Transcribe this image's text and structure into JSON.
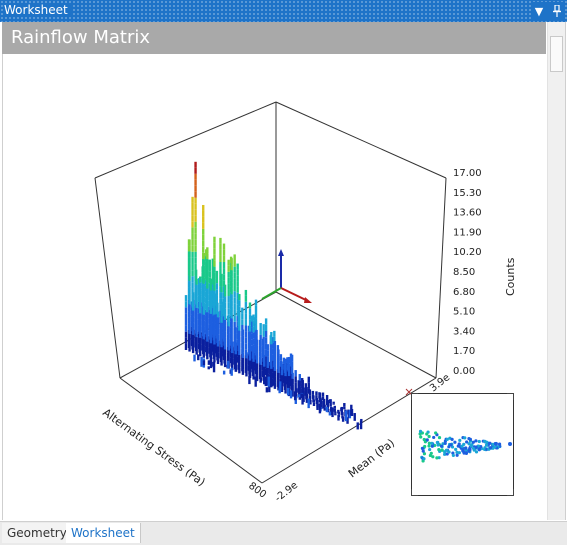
{
  "window": {
    "title": "Worksheet",
    "dropdown_icon": "chevron-down-icon",
    "pin_icon": "pin-icon"
  },
  "header": {
    "title": "Rainflow Matrix"
  },
  "chart_data": {
    "type": "bar3d",
    "z_axis": {
      "label": "Counts",
      "ticks": [
        "17.00",
        "15.30",
        "13.60",
        "11.90",
        "10.20",
        "8.50",
        "6.80",
        "5.10",
        "3.40",
        "1.70",
        "0.00"
      ],
      "range": [
        0,
        17
      ]
    },
    "x_axis": {
      "label": "Alternating Stress (Pa)",
      "end_tick": "800"
    },
    "y_axis": {
      "label": "Mean (Pa)",
      "start_tick": "-2.9e",
      "end_tick": "3.9e"
    },
    "colormap": [
      "#0a1f9e",
      "#1d5fe0",
      "#1aa6d6",
      "#19c98a",
      "#7fd23a",
      "#d9c21e",
      "#d4611b",
      "#b01b1b"
    ]
  },
  "tabs": [
    {
      "label": "Geometry",
      "active": false
    },
    {
      "label": "Worksheet",
      "active": true
    }
  ]
}
